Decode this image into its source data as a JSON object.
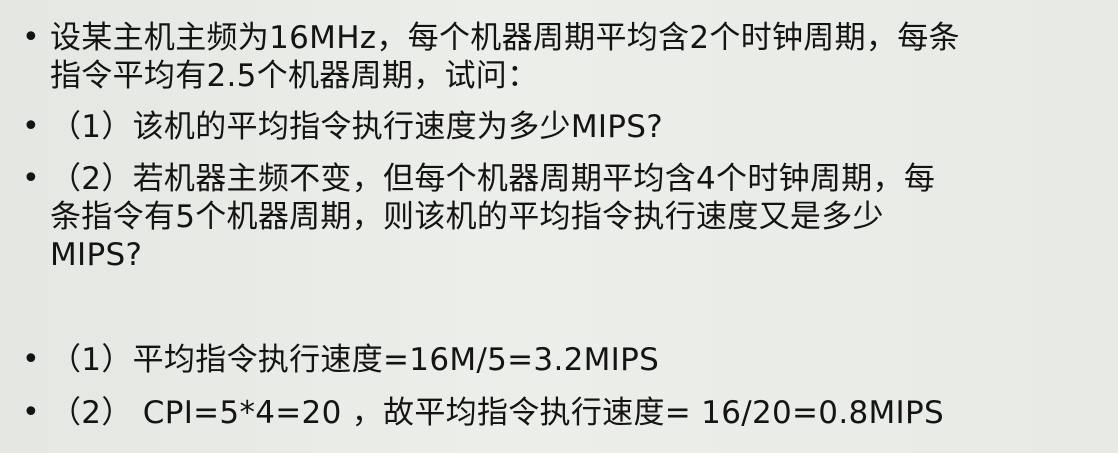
{
  "question": {
    "intro_lines": [
      "设某主机主频为16MHz，每个机器周期平均含2个时钟周期，每条",
      "指令平均有2.5个机器周期，试问："
    ],
    "part1": "（1）该机的平均指令执行速度为多少MIPS?",
    "part2_lines": [
      "（2）若机器主频不变，但每个机器周期平均含4个时钟周期，每",
      "条指令有5个机器周期，则该机的平均指令执行速度又是多少",
      "MIPS?"
    ]
  },
  "answers": {
    "answer1": "（1）平均指令执行速度=16M/5=3.2MIPS",
    "answer2": "（2） CPI=5*4=20 ，故平均指令执行速度= 16/20=0.8MIPS"
  },
  "bullet_symbol": "•"
}
